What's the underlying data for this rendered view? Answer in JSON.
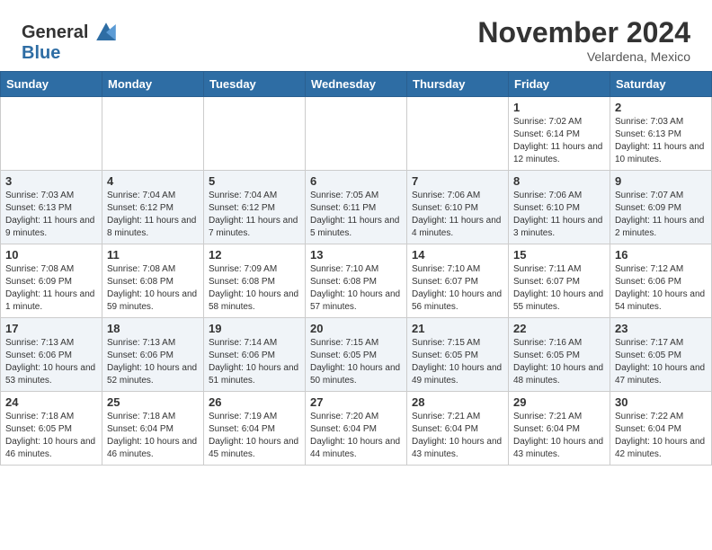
{
  "header": {
    "logo_general": "General",
    "logo_blue": "Blue",
    "month": "November 2024",
    "location": "Velardena, Mexico"
  },
  "weekdays": [
    "Sunday",
    "Monday",
    "Tuesday",
    "Wednesday",
    "Thursday",
    "Friday",
    "Saturday"
  ],
  "weeks": [
    [
      {
        "day": "",
        "info": ""
      },
      {
        "day": "",
        "info": ""
      },
      {
        "day": "",
        "info": ""
      },
      {
        "day": "",
        "info": ""
      },
      {
        "day": "",
        "info": ""
      },
      {
        "day": "1",
        "info": "Sunrise: 7:02 AM\nSunset: 6:14 PM\nDaylight: 11 hours and 12 minutes."
      },
      {
        "day": "2",
        "info": "Sunrise: 7:03 AM\nSunset: 6:13 PM\nDaylight: 11 hours and 10 minutes."
      }
    ],
    [
      {
        "day": "3",
        "info": "Sunrise: 7:03 AM\nSunset: 6:13 PM\nDaylight: 11 hours and 9 minutes."
      },
      {
        "day": "4",
        "info": "Sunrise: 7:04 AM\nSunset: 6:12 PM\nDaylight: 11 hours and 8 minutes."
      },
      {
        "day": "5",
        "info": "Sunrise: 7:04 AM\nSunset: 6:12 PM\nDaylight: 11 hours and 7 minutes."
      },
      {
        "day": "6",
        "info": "Sunrise: 7:05 AM\nSunset: 6:11 PM\nDaylight: 11 hours and 5 minutes."
      },
      {
        "day": "7",
        "info": "Sunrise: 7:06 AM\nSunset: 6:10 PM\nDaylight: 11 hours and 4 minutes."
      },
      {
        "day": "8",
        "info": "Sunrise: 7:06 AM\nSunset: 6:10 PM\nDaylight: 11 hours and 3 minutes."
      },
      {
        "day": "9",
        "info": "Sunrise: 7:07 AM\nSunset: 6:09 PM\nDaylight: 11 hours and 2 minutes."
      }
    ],
    [
      {
        "day": "10",
        "info": "Sunrise: 7:08 AM\nSunset: 6:09 PM\nDaylight: 11 hours and 1 minute."
      },
      {
        "day": "11",
        "info": "Sunrise: 7:08 AM\nSunset: 6:08 PM\nDaylight: 10 hours and 59 minutes."
      },
      {
        "day": "12",
        "info": "Sunrise: 7:09 AM\nSunset: 6:08 PM\nDaylight: 10 hours and 58 minutes."
      },
      {
        "day": "13",
        "info": "Sunrise: 7:10 AM\nSunset: 6:08 PM\nDaylight: 10 hours and 57 minutes."
      },
      {
        "day": "14",
        "info": "Sunrise: 7:10 AM\nSunset: 6:07 PM\nDaylight: 10 hours and 56 minutes."
      },
      {
        "day": "15",
        "info": "Sunrise: 7:11 AM\nSunset: 6:07 PM\nDaylight: 10 hours and 55 minutes."
      },
      {
        "day": "16",
        "info": "Sunrise: 7:12 AM\nSunset: 6:06 PM\nDaylight: 10 hours and 54 minutes."
      }
    ],
    [
      {
        "day": "17",
        "info": "Sunrise: 7:13 AM\nSunset: 6:06 PM\nDaylight: 10 hours and 53 minutes."
      },
      {
        "day": "18",
        "info": "Sunrise: 7:13 AM\nSunset: 6:06 PM\nDaylight: 10 hours and 52 minutes."
      },
      {
        "day": "19",
        "info": "Sunrise: 7:14 AM\nSunset: 6:06 PM\nDaylight: 10 hours and 51 minutes."
      },
      {
        "day": "20",
        "info": "Sunrise: 7:15 AM\nSunset: 6:05 PM\nDaylight: 10 hours and 50 minutes."
      },
      {
        "day": "21",
        "info": "Sunrise: 7:15 AM\nSunset: 6:05 PM\nDaylight: 10 hours and 49 minutes."
      },
      {
        "day": "22",
        "info": "Sunrise: 7:16 AM\nSunset: 6:05 PM\nDaylight: 10 hours and 48 minutes."
      },
      {
        "day": "23",
        "info": "Sunrise: 7:17 AM\nSunset: 6:05 PM\nDaylight: 10 hours and 47 minutes."
      }
    ],
    [
      {
        "day": "24",
        "info": "Sunrise: 7:18 AM\nSunset: 6:05 PM\nDaylight: 10 hours and 46 minutes."
      },
      {
        "day": "25",
        "info": "Sunrise: 7:18 AM\nSunset: 6:04 PM\nDaylight: 10 hours and 46 minutes."
      },
      {
        "day": "26",
        "info": "Sunrise: 7:19 AM\nSunset: 6:04 PM\nDaylight: 10 hours and 45 minutes."
      },
      {
        "day": "27",
        "info": "Sunrise: 7:20 AM\nSunset: 6:04 PM\nDaylight: 10 hours and 44 minutes."
      },
      {
        "day": "28",
        "info": "Sunrise: 7:21 AM\nSunset: 6:04 PM\nDaylight: 10 hours and 43 minutes."
      },
      {
        "day": "29",
        "info": "Sunrise: 7:21 AM\nSunset: 6:04 PM\nDaylight: 10 hours and 43 minutes."
      },
      {
        "day": "30",
        "info": "Sunrise: 7:22 AM\nSunset: 6:04 PM\nDaylight: 10 hours and 42 minutes."
      }
    ]
  ]
}
